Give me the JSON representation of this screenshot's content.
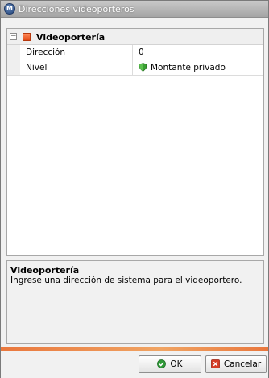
{
  "window": {
    "title": "Direcciones videoporteros",
    "app_icon_glyph": "M"
  },
  "grid": {
    "group": {
      "collapse_glyph": "−",
      "label": "Videoportería"
    },
    "rows": [
      {
        "name": "Dirección",
        "value": "0"
      },
      {
        "name": "Nivel",
        "value": "Montante privado",
        "icon": "green-shield-icon"
      }
    ]
  },
  "description": {
    "title": "Videoportería",
    "text": "Ingrese una dirección de sistema para el videoportero."
  },
  "buttons": {
    "ok_label": "OK",
    "cancel_label": "Cancelar"
  },
  "colors": {
    "accent": "#e9773d",
    "ok_icon": "#2f9a38",
    "cancel_icon": "#d63b25",
    "shield": "#3a9f33"
  }
}
